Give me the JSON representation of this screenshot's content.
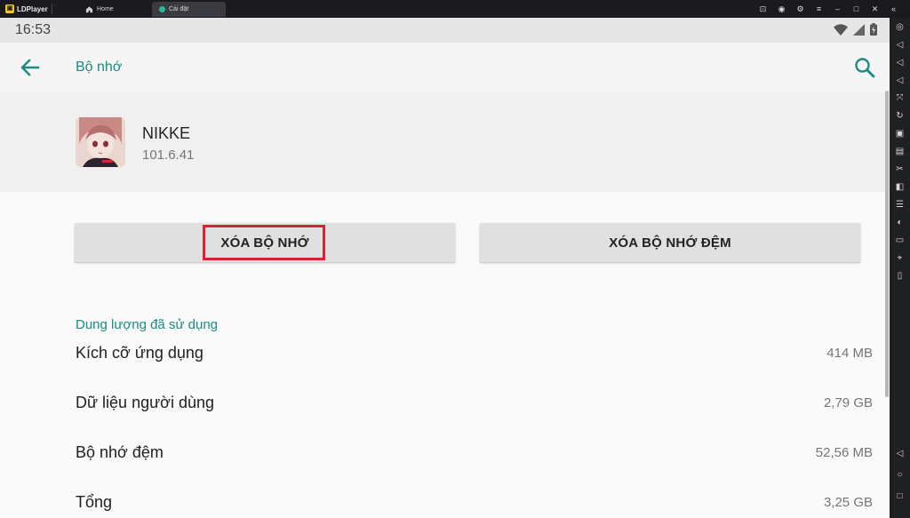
{
  "emulator": {
    "brand": "LDPlayer",
    "tabs": [
      {
        "label": "Home"
      },
      {
        "label": "Cài đặt"
      }
    ],
    "window_controls": [
      "gamepad-icon",
      "account-icon",
      "settings-icon",
      "menu-icon",
      "minimize-icon",
      "maximize-icon",
      "close-icon",
      "collapse-icon"
    ]
  },
  "statusbar": {
    "time": "16:53"
  },
  "appbar": {
    "title": "Bộ nhớ"
  },
  "app": {
    "name": "NIKKE",
    "version": "101.6.41"
  },
  "buttons": {
    "clear_storage": "XÓA BỘ NHỚ",
    "clear_cache": "XÓA BỘ NHỚ ĐỆM"
  },
  "storage": {
    "section_title": "Dung lượng đã sử dụng",
    "rows": [
      {
        "label": "Kích cỡ ứng dụng",
        "value": "414 MB"
      },
      {
        "label": "Dữ liệu người dùng",
        "value": "2,79 GB"
      },
      {
        "label": "Bộ nhớ đệm",
        "value": "52,56 MB"
      },
      {
        "label": "Tổng",
        "value": "3,25 GB"
      }
    ]
  },
  "colors": {
    "accent": "#1a8a82",
    "highlight": "#d9232e"
  }
}
